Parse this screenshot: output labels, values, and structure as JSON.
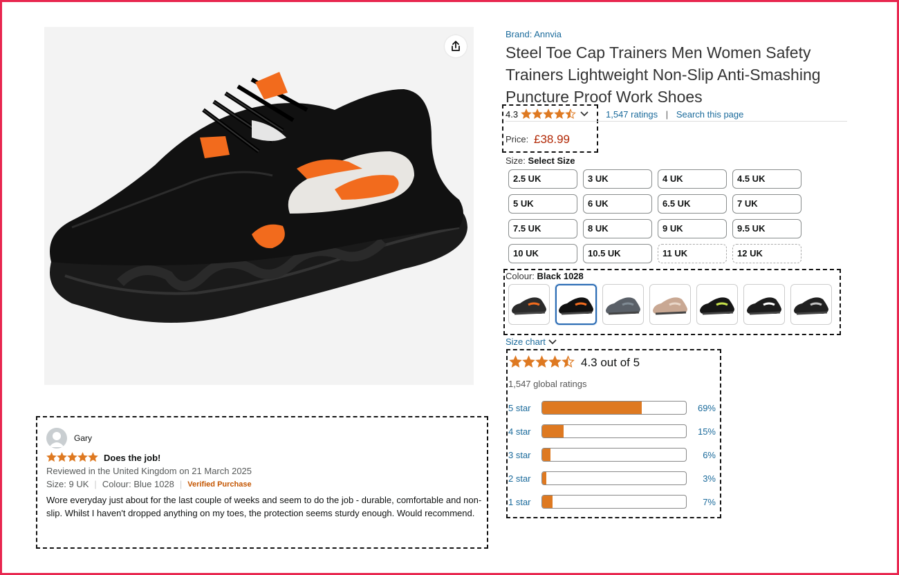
{
  "product": {
    "brand": "Brand: Annvia",
    "title": "Steel Toe Cap Trainers Men Women Safety Trainers Lightweight Non-Slip Anti-Smashing Puncture Proof Work Shoes",
    "rating": "4.3",
    "ratings_link": "1,547 ratings",
    "separator": "|",
    "search_link": "Search this page",
    "price_label": "Price:",
    "price": "£38.99"
  },
  "size": {
    "label": "Size:",
    "selected": "Select Size",
    "options": [
      "2.5 UK",
      "3 UK",
      "4 UK",
      "4.5 UK",
      "5 UK",
      "6 UK",
      "6.5 UK",
      "7 UK",
      "7.5 UK",
      "8 UK",
      "9 UK",
      "9.5 UK",
      "10 UK",
      "10.5 UK",
      "11 UK",
      "12 UK"
    ],
    "unavailable": [
      "11 UK",
      "12 UK"
    ]
  },
  "colour": {
    "label": "Colour:",
    "selected": "Black 1028",
    "swatch_count": 7,
    "selected_index": 1
  },
  "size_chart": "Size chart",
  "ratings_summary": {
    "stars": 4.3,
    "out_of": "4.3 out of 5",
    "global": "1,547 global ratings",
    "histogram": [
      {
        "label": "5 star",
        "pct": "69%",
        "value": 69
      },
      {
        "label": "4 star",
        "pct": "15%",
        "value": 15
      },
      {
        "label": "3 star",
        "pct": "6%",
        "value": 6
      },
      {
        "label": "2 star",
        "pct": "3%",
        "value": 3
      },
      {
        "label": "1 star",
        "pct": "7%",
        "value": 7
      }
    ]
  },
  "review": {
    "author": "Gary",
    "stars": 5,
    "title": "Does the job!",
    "date": "Reviewed in the United Kingdom on 21 March 2025",
    "size": "Size: 9 UK",
    "colour": "Colour: Blue 1028",
    "divider": "|",
    "verified": "Verified Purchase",
    "body": "Wore everyday just about for the last couple of weeks and seem to do the job - durable, comfortable and non-slip. Whilst I haven't dropped anything on my toes, the protection seems sturdy enough. Would recommend."
  },
  "colors": {
    "accent_star": "#de7921",
    "link": "#1a6a9b",
    "price": "#b12704",
    "frame": "#e8264f"
  }
}
